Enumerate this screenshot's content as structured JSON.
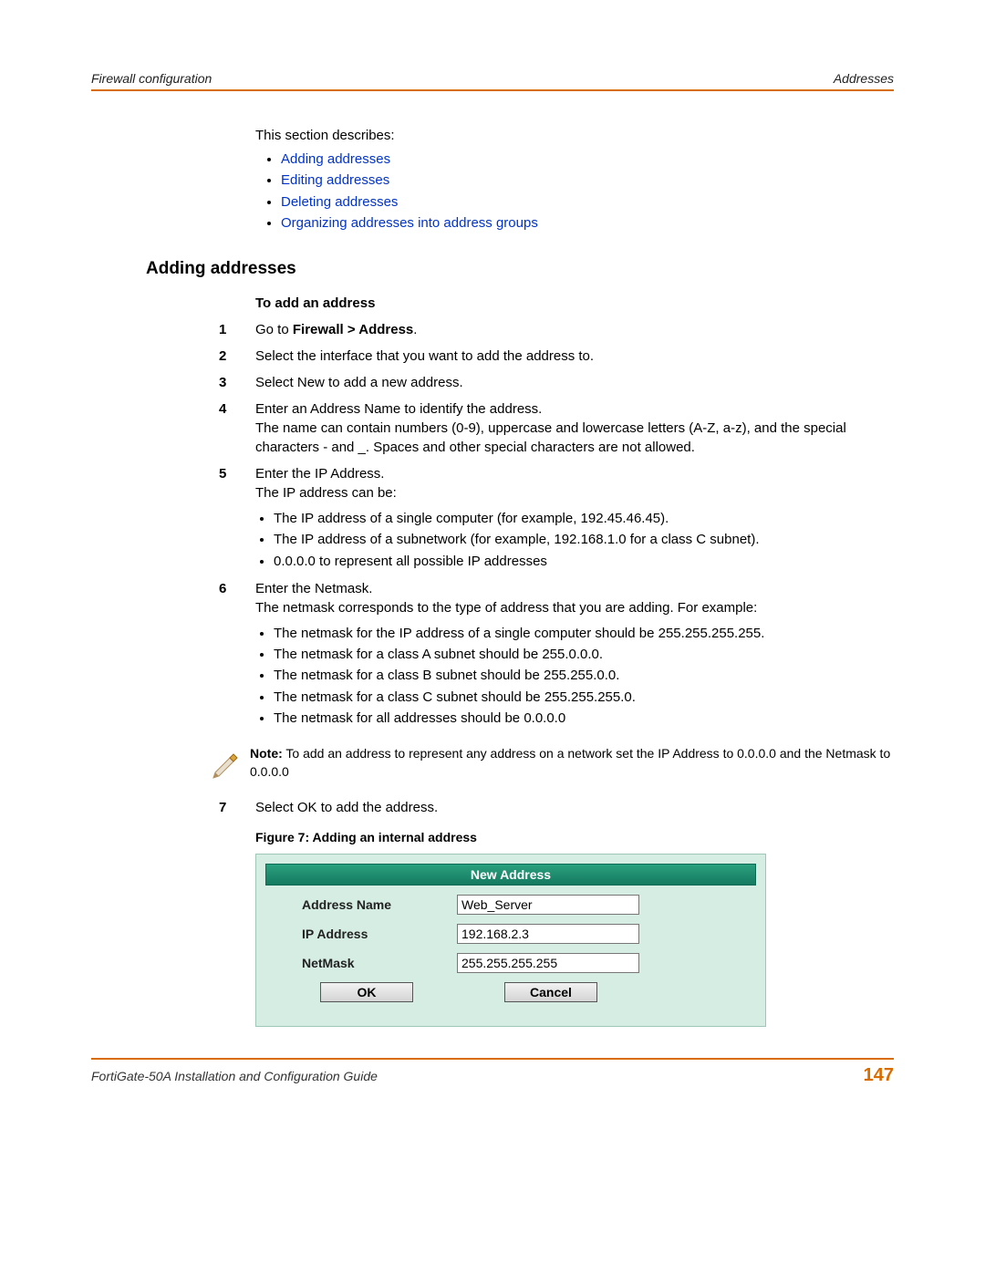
{
  "header": {
    "left": "Firewall configuration",
    "right": "Addresses"
  },
  "toc": {
    "intro": "This section describes:",
    "links": [
      "Adding addresses",
      "Editing addresses",
      "Deleting addresses",
      "Organizing addresses into address groups"
    ]
  },
  "section_heading": "Adding addresses",
  "procedure_title": "To add an address",
  "steps": [
    {
      "n": "1",
      "text_pre": "Go to ",
      "text_bold": "Firewall > Address",
      "text_post": "."
    },
    {
      "n": "2",
      "text": "Select the interface that you want to add the address to."
    },
    {
      "n": "3",
      "text": "Select New to add a new address."
    },
    {
      "n": "4",
      "text": "Enter an Address Name to identify the address.",
      "para2": "The name can contain numbers (0-9), uppercase and lowercase letters (A-Z, a-z), and the special characters - and _. Spaces and other special characters are not allowed."
    },
    {
      "n": "5",
      "text": "Enter the IP Address.",
      "para2": "The IP address can be:",
      "bullets": [
        "The IP address of a single computer (for example, 192.45.46.45).",
        "The IP address of a subnetwork (for example, 192.168.1.0 for a class C subnet).",
        "0.0.0.0 to represent all possible IP addresses"
      ]
    },
    {
      "n": "6",
      "text": "Enter the Netmask.",
      "para2": "The netmask corresponds to the type of address that you are adding. For example:",
      "bullets": [
        "The netmask for the IP address of a single computer should be 255.255.255.255.",
        "The netmask for a class A subnet should be 255.0.0.0.",
        "The netmask for a class B subnet should be 255.255.0.0.",
        "The netmask for a class C subnet should be 255.255.255.0.",
        "The netmask for all addresses should be 0.0.0.0"
      ]
    }
  ],
  "note": {
    "label": "Note:",
    "text": " To add an address to represent any address on a network set the IP Address to 0.0.0.0 and the Netmask to 0.0.0.0"
  },
  "step7": {
    "n": "7",
    "text": "Select OK to add the address."
  },
  "figure": {
    "caption": "Figure 7:   Adding an internal address",
    "titlebar": "New Address",
    "rows": {
      "name_label": "Address Name",
      "name_value": "Web_Server",
      "ip_label": "IP Address",
      "ip_value": "192.168.2.3",
      "mask_label": "NetMask",
      "mask_value": "255.255.255.255"
    },
    "buttons": {
      "ok": "OK",
      "cancel": "Cancel"
    }
  },
  "footer": {
    "left": "FortiGate-50A Installation and Configuration Guide",
    "pagenum": "147"
  }
}
